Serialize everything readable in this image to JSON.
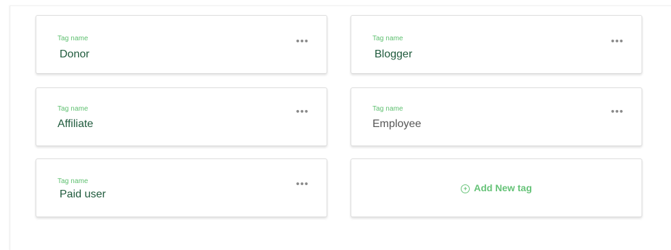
{
  "tags": [
    {
      "caption": "Tag name",
      "value": "Donor"
    },
    {
      "caption": "Tag name",
      "value": "Blogger"
    },
    {
      "caption": "Tag name",
      "value": "Affiliate"
    },
    {
      "caption": "Tag name",
      "value": "Employee"
    },
    {
      "caption": "Tag name",
      "value": "Paid user"
    }
  ],
  "more_icon": "more-horizontal-icon",
  "more_glyph": "•••",
  "add_tag": {
    "label": "Add New tag",
    "icon": "plus-circle-icon",
    "icon_glyph": "+"
  },
  "colors": {
    "accent": "#66c378",
    "caption": "#5cbf6e",
    "value": "#1f5a3c"
  }
}
